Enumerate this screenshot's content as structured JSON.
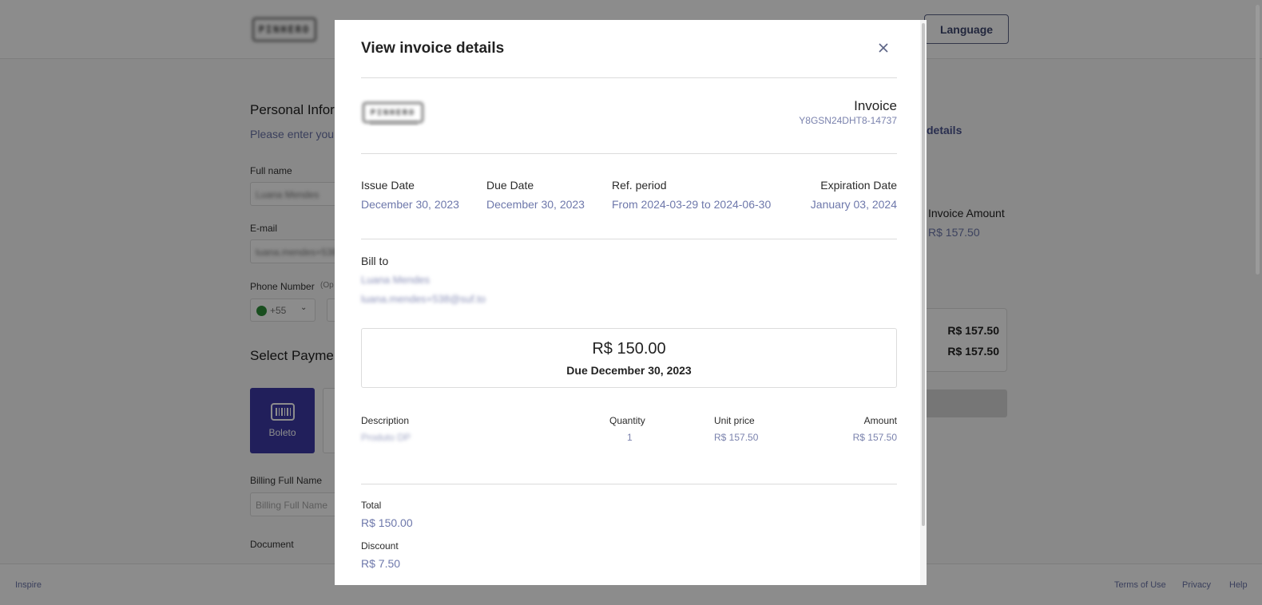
{
  "header": {
    "logo_text": "PINHERO",
    "language_label": "Language"
  },
  "background": {
    "personal_info_title": "Personal Infor",
    "personal_info_subtitle": "Please enter your",
    "full_name_label": "Full name",
    "full_name_value": "Luana Mendes",
    "email_label": "E-mail",
    "email_value": "luana.mendes+538",
    "phone_label": "Phone Number",
    "phone_optional": "(Op",
    "phone_country_code": "+55",
    "payment_title": "Select Payme",
    "boleto_label": "Boleto",
    "billing_full_name_label": "Billing Full Name",
    "billing_full_name_placeholder": "Billing Full Name",
    "document_label": "Document",
    "details_link": "details",
    "invoice_amount_label": "Invoice Amount",
    "invoice_amount_value": "R$ 157.50",
    "summary_values": [
      "R$ 157.50",
      "R$ 157.50"
    ]
  },
  "modal": {
    "title": "View invoice details",
    "close_icon": "close-icon",
    "invoice_label": "Invoice",
    "invoice_number": "Y8GSN24DHT8-14737",
    "dates": {
      "issue_label": "Issue Date",
      "issue_value": "December 30, 2023",
      "due_label": "Due Date",
      "due_value": "December 30, 2023",
      "ref_label": "Ref. period",
      "ref_value": "From 2024-03-29 to 2024-06-30",
      "expiration_label": "Expiration Date",
      "expiration_value": "January 03, 2024"
    },
    "bill_to": {
      "label": "Bill to",
      "name": "Luana Mendes",
      "email": "luana.mendes+538@suf.to"
    },
    "amount_box": {
      "amount": "R$ 150.00",
      "due": "Due December 30, 2023"
    },
    "table": {
      "headers": {
        "description": "Description",
        "quantity": "Quantity",
        "unit_price": "Unit price",
        "amount": "Amount"
      },
      "rows": [
        {
          "description": "Produto DP",
          "quantity": "1",
          "unit_price": "R$ 157.50",
          "amount": "R$ 157.50"
        }
      ]
    },
    "totals": {
      "total_label": "Total",
      "total_value": "R$ 150.00",
      "discount_label": "Discount",
      "discount_value": "R$ 7.50"
    }
  },
  "footer": {
    "left_link": "Inspire",
    "terms": "Terms of Use",
    "privacy": "Privacy",
    "help": "Help"
  },
  "colors": {
    "accent": "#6e78ab",
    "boleto": "#3d3aa6",
    "overlay": "#000000"
  }
}
